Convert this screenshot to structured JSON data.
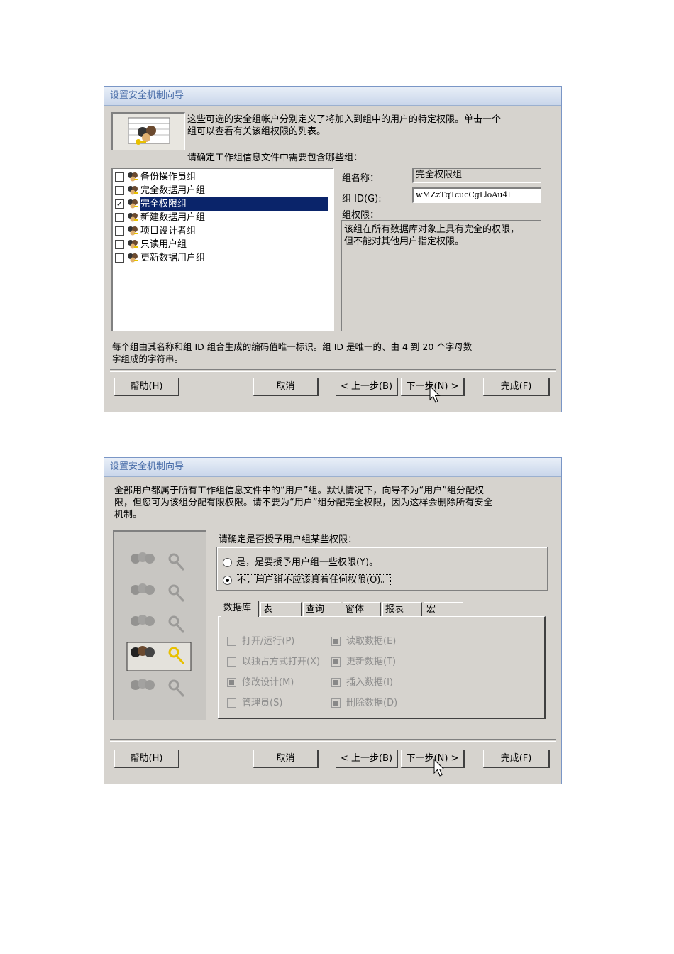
{
  "dialog1": {
    "title": "设置安全机制向导",
    "intro_line1": "这些可选的安全组帐户分别定义了将加入到组中的用户的特定权限。单击一个",
    "intro_line2": "组可以查看有关该组权限的列表。",
    "prompt": "请确定工作组信息文件中需要包含哪些组：",
    "groups": [
      {
        "label": "备份操作员组",
        "checked": false
      },
      {
        "label": "完全数据用户组",
        "checked": false
      },
      {
        "label": "完全权限组",
        "checked": true
      },
      {
        "label": "新建数据用户组",
        "checked": false
      },
      {
        "label": "项目设计者组",
        "checked": false
      },
      {
        "label": "只读用户组",
        "checked": false
      },
      {
        "label": "更新数据用户组",
        "checked": false
      }
    ],
    "check_mark": "✓",
    "group_name_label": "组名称：",
    "group_name_value": "完全权限组",
    "group_id_label": "组 ID(G):",
    "group_id_value": "wMZzTqTcucCgLloAu4I",
    "group_perm_label": "组权限：",
    "group_perm_text_line1": "该组在所有数据库对象上具有完全的权限，",
    "group_perm_text_line2": "但不能对其他用户指定权限。",
    "footer_line1": "每个组由其名称和组 ID 组合生成的编码值唯一标识。组 ID 是唯一的、由 4 到 20 个字母数",
    "footer_line2": "字组成的字符串。"
  },
  "dialog2": {
    "title": "设置安全机制向导",
    "intro_line1": "全部用户都属于所有工作组信息文件中的“用户”组。默认情况下，向导不为“用户”组分配权",
    "intro_line2": "限，但您可为该组分配有限权限。请不要为“用户”组分配完全权限，因为这样会删除所有安全",
    "intro_line3": "机制。",
    "prompt": "请确定是否授予用户组某些权限：",
    "radio_yes": "是，是要授予用户组一些权限(Y)。",
    "radio_no": "不，用户组不应该具有任何权限(O)。",
    "tabs": [
      "数据库",
      "表",
      "查询",
      "窗体",
      "报表",
      "宏"
    ],
    "perms_left": [
      {
        "label": "打开/运行(P)",
        "checked": false
      },
      {
        "label": "以独占方式打开(X)",
        "checked": false
      },
      {
        "label": "修改设计(M)",
        "checked": true
      },
      {
        "label": "管理员(S)",
        "checked": false
      }
    ],
    "perms_right": [
      {
        "label": "读取数据(E)",
        "checked": true
      },
      {
        "label": "更新数据(T)",
        "checked": true
      },
      {
        "label": "插入数据(I)",
        "checked": true
      },
      {
        "label": "删除数据(D)",
        "checked": true
      }
    ]
  },
  "buttons": {
    "help": "帮助(H)",
    "cancel": "取消",
    "back": "< 上一步(B)",
    "next": "下一步(N) >",
    "finish": "完成(F)"
  }
}
